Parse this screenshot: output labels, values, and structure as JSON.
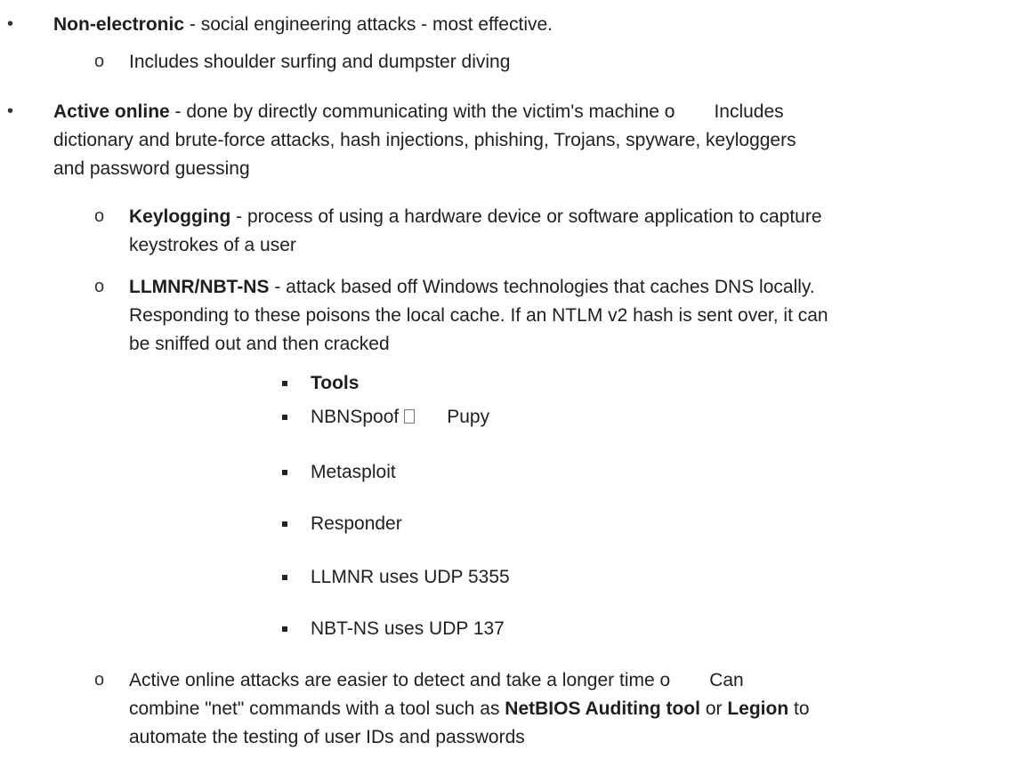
{
  "items": {
    "nonelectronic": {
      "term": "Non-electronic",
      "desc": " - social engineering attacks - most effective.",
      "sub": "Includes shoulder surfing and dumpster diving"
    },
    "active_online": {
      "term": "Active online",
      "desc_line1": " - done by directly communicating with the victim's machine ",
      "inline_o": "o",
      "includes": "Includes",
      "line2": "dictionary and brute-force attacks, hash injections, phishing, Trojans, spyware, keyloggers",
      "line3": "and password guessing"
    },
    "keylogging": {
      "term": "Keylogging",
      "desc_line1": " - process of using a hardware device or software application to capture",
      "line2": "keystrokes of a user"
    },
    "llmnr": {
      "term": "LLMNR/NBT-NS",
      "desc_line1": " - attack based off Windows technologies that caches DNS locally.",
      "line2": "Responding to these poisons the local cache. If an NTLM v2 hash is sent over, it can",
      "line3": "be sniffed out and then cracked"
    },
    "tools": {
      "heading": "Tools",
      "nbnspoof": "NBNSpoof",
      "pupy": "Pupy",
      "list": [
        "Metasploit",
        "Responder",
        "LLMNR uses UDP 5355",
        "NBT-NS uses UDP 137"
      ]
    },
    "active_attacks": {
      "line1": "Active online attacks are easier to detect and take a longer time ",
      "inline_o": "o",
      "can": "Can",
      "line2_a": "combine \"net\" commands with a tool such as ",
      "netbios": "NetBIOS Auditing tool",
      "or": " or ",
      "legion": "Legion",
      "line2_b": " to",
      "line3": "automate the testing of user IDs and passwords"
    }
  },
  "markers": {
    "bullet": "•",
    "circle": "o"
  }
}
